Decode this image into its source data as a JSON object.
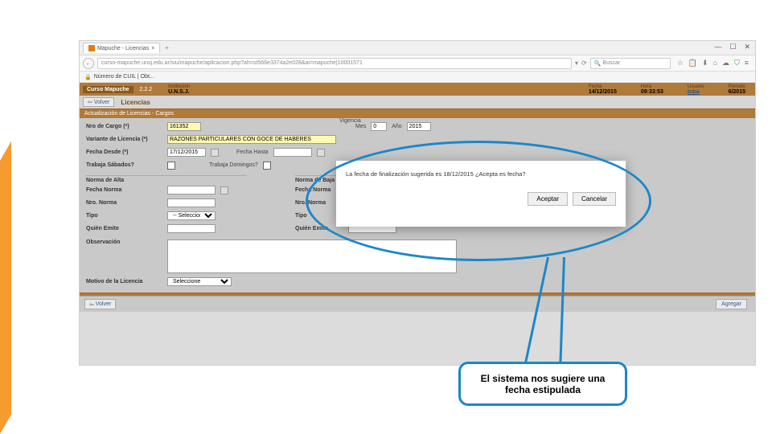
{
  "browser": {
    "tab_title": "Mapuche - Licencias",
    "url": "curso-mapuche.unsj.edu.ar/siu/mapuche/aplicacion.php?ah=st566e3374a2e028&ai=mapuche|10001571",
    "search_placeholder": "Buscar",
    "bookmark": "Número de CUIL | Obt..."
  },
  "win": {
    "min": "—",
    "max": "☐",
    "close": "✕"
  },
  "app": {
    "logo": "Curso Mapuche",
    "version": "2.2.2",
    "institucion_label": "Institución",
    "institucion": "U.N.S.J.",
    "fecha_label": "Fecha",
    "fecha": "14/12/2015",
    "hora_label": "Hora",
    "hora": "09:33:53",
    "usuario_label": "Usuario",
    "usuario": "toba",
    "periodo_label": "Período",
    "periodo": "6/2015"
  },
  "sub": {
    "volver": "Volver",
    "title": "Licencias"
  },
  "section": "Actualización de Licencias - Cargos",
  "form": {
    "nro_cargo_label": "Nro de Cargo (*)",
    "nro_cargo": "161352",
    "variante_label": "Variante de Licencia (*)",
    "variante": "RAZONES PARTICULARES CON GOCE DE HABERES",
    "vigencia": "Vigencia",
    "mes_label": "Mes",
    "mes": "0",
    "anio_label": "Año",
    "anio": "2015",
    "desde_label": "Fecha Desde (*)",
    "desde": "17/12/2015",
    "hasta_label": "Fecha Hasta",
    "sab_label": "Trabaja Sábados?",
    "dom_label": "Trabaja Domingos?",
    "norma_alta": "Norma de Alta",
    "norma_baja": "Norma de Baja",
    "fecha_norma": "Fecha Norma",
    "nro_norma": "Nro. Norma",
    "tipo": "Tipo",
    "tipo_val": "-- Seleccione --",
    "quien": "Quién Emite",
    "obs": "Observación",
    "motivo": "Motivo de la Licencia",
    "motivo_val": "Seleccione"
  },
  "footer": {
    "volver": "Volver",
    "agregar": "Agregar"
  },
  "modal": {
    "msg": "La fecha de finalización sugerida es 18/12/2015 ¿Acepta es fecha?",
    "accept": "Aceptar",
    "cancel": "Cancelar"
  },
  "callout": "El sistema nos sugiere una fecha estipulada"
}
